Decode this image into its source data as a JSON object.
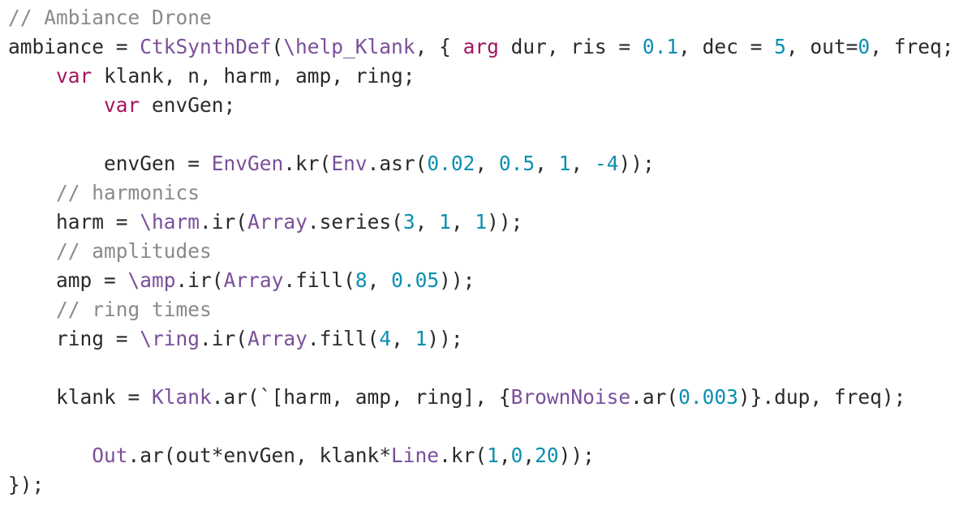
{
  "editor": {
    "colors": {
      "plain": "#2a2a2a",
      "comment": "#8a8a8a",
      "class": "#7a4f9a",
      "keyword": "#a3155f",
      "number": "#0a8fb0",
      "symbol": "#7a4f9a"
    },
    "lines": [
      {
        "indent": "",
        "tokens": [
          {
            "t": "comment",
            "v": "// Ambiance Drone"
          }
        ]
      },
      {
        "indent": "",
        "tokens": [
          {
            "t": "plain",
            "v": "ambiance = "
          },
          {
            "t": "class",
            "v": "CtkSynthDef"
          },
          {
            "t": "plain",
            "v": "("
          },
          {
            "t": "symbol",
            "v": "\\help_Klank"
          },
          {
            "t": "plain",
            "v": ", { "
          },
          {
            "t": "keyword",
            "v": "arg"
          },
          {
            "t": "plain",
            "v": " dur, ris = "
          },
          {
            "t": "number",
            "v": "0.1"
          },
          {
            "t": "plain",
            "v": ", dec = "
          },
          {
            "t": "number",
            "v": "5"
          },
          {
            "t": "plain",
            "v": ", out="
          },
          {
            "t": "number",
            "v": "0"
          },
          {
            "t": "plain",
            "v": ", freq;"
          }
        ]
      },
      {
        "indent": "    ",
        "tokens": [
          {
            "t": "keyword",
            "v": "var"
          },
          {
            "t": "plain",
            "v": " klank, n, harm, amp, ring;"
          }
        ]
      },
      {
        "indent": "        ",
        "tokens": [
          {
            "t": "keyword",
            "v": "var"
          },
          {
            "t": "plain",
            "v": " envGen;"
          }
        ]
      },
      {
        "indent": "",
        "tokens": []
      },
      {
        "indent": "        ",
        "tokens": [
          {
            "t": "plain",
            "v": "envGen = "
          },
          {
            "t": "class",
            "v": "EnvGen"
          },
          {
            "t": "plain",
            "v": ".kr("
          },
          {
            "t": "class",
            "v": "Env"
          },
          {
            "t": "plain",
            "v": ".asr("
          },
          {
            "t": "number",
            "v": "0.02"
          },
          {
            "t": "plain",
            "v": ", "
          },
          {
            "t": "number",
            "v": "0.5"
          },
          {
            "t": "plain",
            "v": ", "
          },
          {
            "t": "number",
            "v": "1"
          },
          {
            "t": "plain",
            "v": ", "
          },
          {
            "t": "number",
            "v": "-4"
          },
          {
            "t": "plain",
            "v": "));"
          }
        ]
      },
      {
        "indent": "    ",
        "tokens": [
          {
            "t": "comment",
            "v": "// harmonics"
          }
        ]
      },
      {
        "indent": "    ",
        "tokens": [
          {
            "t": "plain",
            "v": "harm = "
          },
          {
            "t": "symbol",
            "v": "\\harm"
          },
          {
            "t": "plain",
            "v": ".ir("
          },
          {
            "t": "class",
            "v": "Array"
          },
          {
            "t": "plain",
            "v": ".series("
          },
          {
            "t": "number",
            "v": "3"
          },
          {
            "t": "plain",
            "v": ", "
          },
          {
            "t": "number",
            "v": "1"
          },
          {
            "t": "plain",
            "v": ", "
          },
          {
            "t": "number",
            "v": "1"
          },
          {
            "t": "plain",
            "v": "));"
          }
        ]
      },
      {
        "indent": "    ",
        "tokens": [
          {
            "t": "comment",
            "v": "// amplitudes"
          }
        ]
      },
      {
        "indent": "    ",
        "tokens": [
          {
            "t": "plain",
            "v": "amp = "
          },
          {
            "t": "symbol",
            "v": "\\amp"
          },
          {
            "t": "plain",
            "v": ".ir("
          },
          {
            "t": "class",
            "v": "Array"
          },
          {
            "t": "plain",
            "v": ".fill("
          },
          {
            "t": "number",
            "v": "8"
          },
          {
            "t": "plain",
            "v": ", "
          },
          {
            "t": "number",
            "v": "0.05"
          },
          {
            "t": "plain",
            "v": "));"
          }
        ]
      },
      {
        "indent": "    ",
        "tokens": [
          {
            "t": "comment",
            "v": "// ring times"
          }
        ]
      },
      {
        "indent": "    ",
        "tokens": [
          {
            "t": "plain",
            "v": "ring = "
          },
          {
            "t": "symbol",
            "v": "\\ring"
          },
          {
            "t": "plain",
            "v": ".ir("
          },
          {
            "t": "class",
            "v": "Array"
          },
          {
            "t": "plain",
            "v": ".fill("
          },
          {
            "t": "number",
            "v": "4"
          },
          {
            "t": "plain",
            "v": ", "
          },
          {
            "t": "number",
            "v": "1"
          },
          {
            "t": "plain",
            "v": "));"
          }
        ]
      },
      {
        "indent": "",
        "tokens": []
      },
      {
        "indent": "    ",
        "tokens": [
          {
            "t": "plain",
            "v": "klank = "
          },
          {
            "t": "class",
            "v": "Klank"
          },
          {
            "t": "plain",
            "v": ".ar(`[harm, amp, ring], {"
          },
          {
            "t": "class",
            "v": "BrownNoise"
          },
          {
            "t": "plain",
            "v": ".ar("
          },
          {
            "t": "number",
            "v": "0.003"
          },
          {
            "t": "plain",
            "v": ")}.dup, freq);"
          }
        ]
      },
      {
        "indent": "",
        "tokens": []
      },
      {
        "indent": "       ",
        "tokens": [
          {
            "t": "class",
            "v": "Out"
          },
          {
            "t": "plain",
            "v": ".ar(out*envGen, klank*"
          },
          {
            "t": "class",
            "v": "Line"
          },
          {
            "t": "plain",
            "v": ".kr("
          },
          {
            "t": "number",
            "v": "1"
          },
          {
            "t": "plain",
            "v": ","
          },
          {
            "t": "number",
            "v": "0"
          },
          {
            "t": "plain",
            "v": ","
          },
          {
            "t": "number",
            "v": "20"
          },
          {
            "t": "plain",
            "v": "));"
          }
        ]
      },
      {
        "indent": "",
        "tokens": [
          {
            "t": "plain",
            "v": "});"
          }
        ]
      }
    ]
  }
}
